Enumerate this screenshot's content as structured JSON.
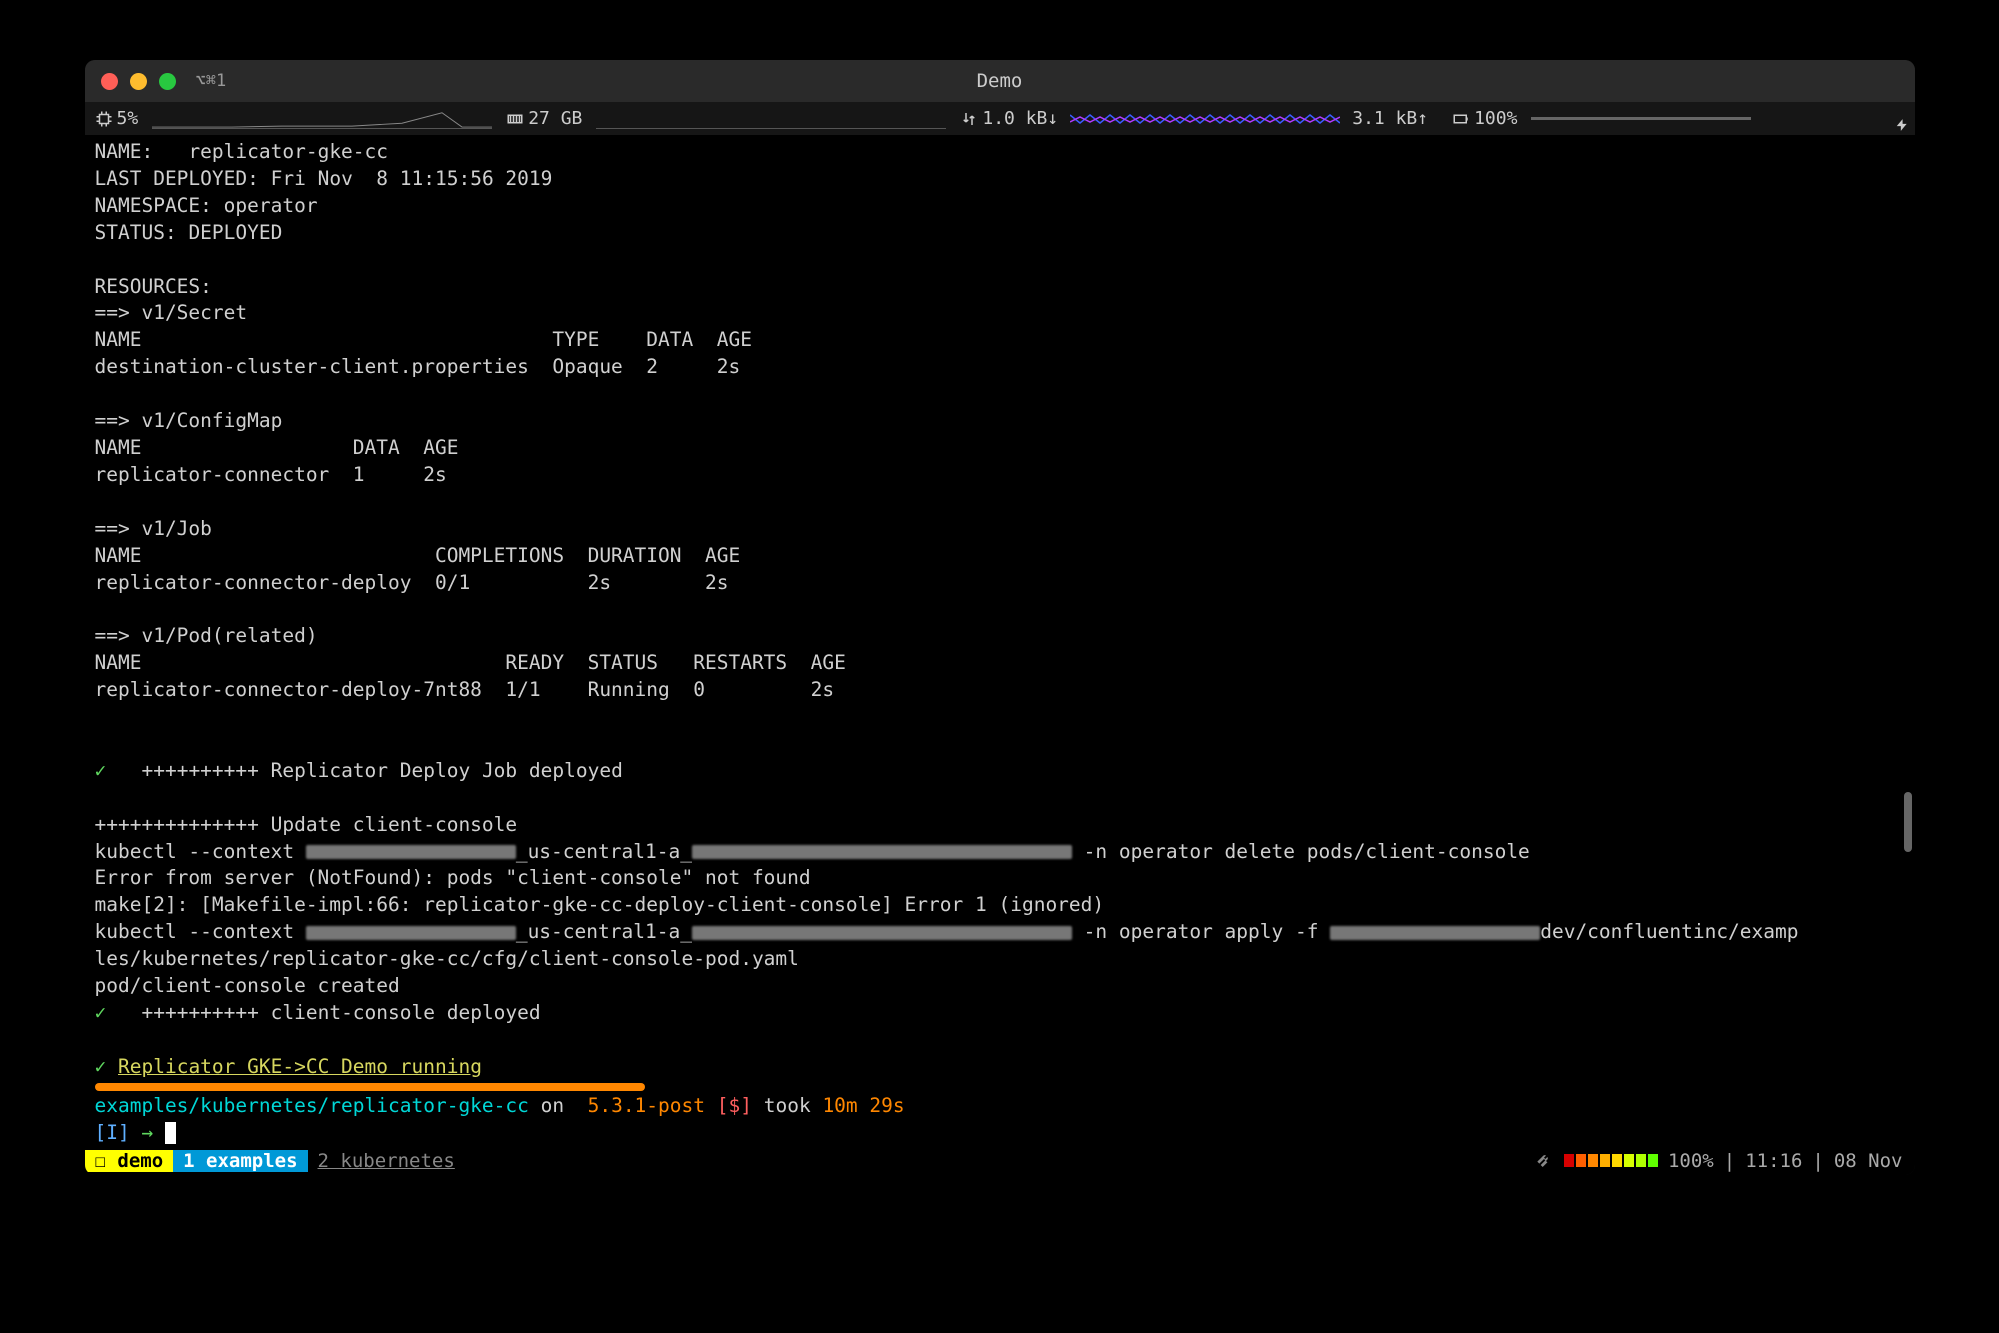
{
  "window": {
    "title": "Demo",
    "shortcut_hint": "⌥⌘1"
  },
  "stats": {
    "cpu": "5%",
    "mem": "27 GB",
    "net_down": "1.0 kB↓",
    "net_up": "3.1 kB↑",
    "battery": "100%"
  },
  "helm": {
    "name_label": "NAME:",
    "name": "replicator-gke-cc",
    "deployed_label": "LAST DEPLOYED:",
    "deployed": "Fri Nov  8 11:15:56 2019",
    "namespace_label": "NAMESPACE:",
    "namespace": "operator",
    "status_label": "STATUS:",
    "status": "DEPLOYED",
    "resources_label": "RESOURCES:"
  },
  "secret": {
    "header": "==> v1/Secret",
    "cols": "NAME                                   TYPE    DATA  AGE",
    "row": "destination-cluster-client.properties  Opaque  2     2s"
  },
  "configmap": {
    "header": "==> v1/ConfigMap",
    "cols": "NAME                  DATA  AGE",
    "row": "replicator-connector  1     2s"
  },
  "job": {
    "header": "==> v1/Job",
    "cols": "NAME                         COMPLETIONS  DURATION  AGE",
    "row": "replicator-connector-deploy  0/1          2s        2s"
  },
  "pod": {
    "header": "==> v1/Pod(related)",
    "cols": "NAME                               READY  STATUS   RESTARTS  AGE",
    "row": "replicator-connector-deploy-7nt88  1/1    Running  0         2s"
  },
  "log": {
    "deploy_ok": "++++++++++ Replicator Deploy Job deployed",
    "update_hdr": "++++++++++++++ Update client-console",
    "kubectl_prefix": "kubectl --context ",
    "region_frag": "_us-central1-a_",
    "delete_suffix": " -n operator delete pods/client-console",
    "not_found": "Error from server (NotFound): pods \"client-console\" not found",
    "make_err": "make[2]: [Makefile-impl:66: replicator-gke-cc-deploy-client-console] Error 1 (ignored)",
    "apply_suffix": " -n operator apply -f ",
    "apply_path1": "dev/confluentinc/examp",
    "apply_path2": "les/kubernetes/replicator-gke-cc/cfg/client-console-pod.yaml",
    "pod_created": "pod/client-console created",
    "console_ok": "++++++++++ client-console deployed",
    "demo_ok": "Replicator GKE->CC Demo running"
  },
  "prompt": {
    "path": "examples/kubernetes/replicator-gke-cc",
    "on": " on ",
    "branch_icon": "",
    "branch": " 5.3.1-post ",
    "dirty": "[$]",
    "took_label": " took ",
    "took": "10m 29s",
    "vi": "[I]",
    "arrow": "→"
  },
  "tmux": {
    "session": "☐ demo",
    "win1": "1 examples",
    "win2": "2 kubernetes",
    "load": "100%",
    "time": "11:16",
    "date": "08 Nov"
  }
}
